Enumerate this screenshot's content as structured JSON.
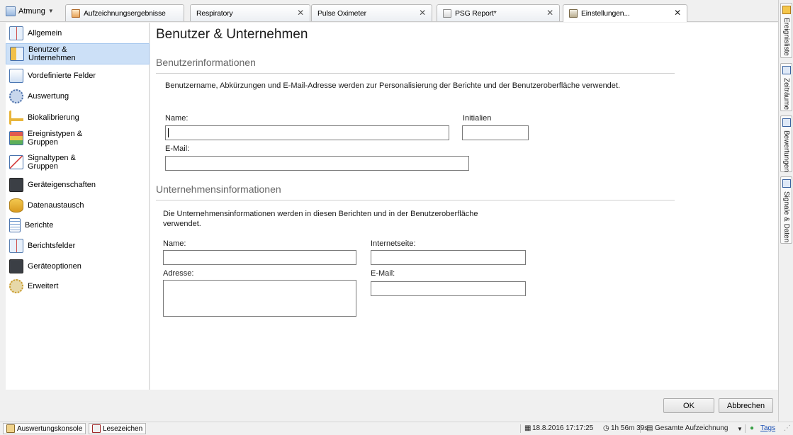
{
  "tabbar": {
    "doc_dropdown": "Atmung",
    "tabs": [
      {
        "label": "Aufzeichnungsergebnisse",
        "closable": false
      },
      {
        "label": "Respiratory",
        "closable": true
      },
      {
        "label": "Pulse Oximeter",
        "closable": true
      },
      {
        "label": "PSG Report*",
        "closable": true
      },
      {
        "label": "Einstellungen...",
        "closable": true,
        "active": true
      }
    ]
  },
  "nav": {
    "items": [
      {
        "label": "Allgemein",
        "icon": "checklist-icon"
      },
      {
        "label": "Benutzer & Unternehmen",
        "icon": "user-card-icon",
        "selected": true
      },
      {
        "label": "Vordefinierte Felder",
        "icon": "form-edit-icon"
      },
      {
        "label": "Auswertung",
        "icon": "gears-icon"
      },
      {
        "label": "Biokalibrierung",
        "icon": "calibration-icon"
      },
      {
        "label": "Ereignistypen & Gruppen",
        "icon": "event-types-icon"
      },
      {
        "label": "Signaltypen & Gruppen",
        "icon": "signal-types-icon"
      },
      {
        "label": "Geräteigenschaften",
        "icon": "device-icon"
      },
      {
        "label": "Datenaustausch",
        "icon": "database-exchange-icon"
      },
      {
        "label": "Berichte",
        "icon": "report-icon"
      },
      {
        "label": "Berichtsfelder",
        "icon": "report-fields-icon"
      },
      {
        "label": "Geräteoptionen",
        "icon": "device-options-icon"
      },
      {
        "label": "Erweitert",
        "icon": "advanced-gears-icon"
      }
    ]
  },
  "main": {
    "title": "Benutzer & Unternehmen",
    "user_section": {
      "heading": "Benutzerinformationen",
      "description": "Benutzername, Abkürzungen und E-Mail-Adresse werden zur Personalisierung der Berichte und der Benutzeroberfläche verwendet.",
      "name_label": "Name:",
      "name_value": "",
      "initials_label": "Initialien",
      "initials_value": "",
      "email_label": "E-Mail:",
      "email_value": ""
    },
    "company_section": {
      "heading": "Unternehmensinformationen",
      "description": "Die Unternehmensinformationen werden in diesen Berichten und in der Benutzeroberfläche verwendet.",
      "name_label": "Name:",
      "website_label": "Internetseite:",
      "address_label": "Adresse:",
      "email_label": "E-Mail:"
    }
  },
  "buttons": {
    "ok": "OK",
    "cancel": "Abbrechen"
  },
  "dock": {
    "tabs": [
      "Ereignisliste",
      "Zeiträume",
      "Bewertungen",
      "Signale & Daten"
    ]
  },
  "statusbar": {
    "console": "Auswertungskonsole",
    "bookmarks": "Lesezeichen",
    "datetime": "18.8.2016 17:17:25",
    "duration": "1h 56m 39s",
    "range": "Gesamte Aufzeichnung",
    "tags": "Tags"
  },
  "colors": {
    "selection": "#cce0f7",
    "link": "#1a4fb5",
    "heading": "#666666"
  }
}
